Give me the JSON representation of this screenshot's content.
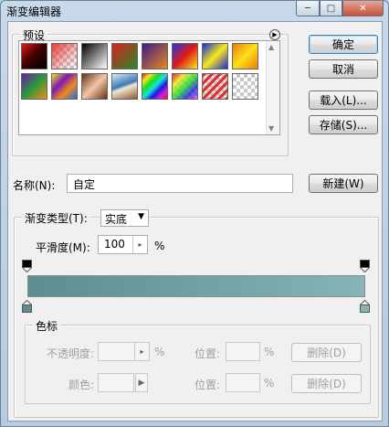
{
  "window": {
    "title": "渐变编辑器",
    "controls": {
      "minimize": "─",
      "maximize": "□",
      "close": "✕"
    }
  },
  "presets": {
    "label": "预设",
    "menu_icon": "right-arrow-circle",
    "swatches": [
      {
        "name": "foreground-to-background",
        "css": "linear-gradient(135deg,#e21a1a 0%,#400 45%,#000 100%)"
      },
      {
        "name": "foreground-to-transparent",
        "css": "linear-gradient(135deg,#e63c3c 0%,rgba(230,60,60,0.3) 60%,rgba(230,60,60,0) 100%)",
        "checker": true
      },
      {
        "name": "black-white",
        "css": "linear-gradient(135deg,#000 0%,#fff 100%)"
      },
      {
        "name": "red-green",
        "css": "linear-gradient(135deg,#d62020 0%,#2a8a2a 100%)"
      },
      {
        "name": "violet-orange",
        "css": "linear-gradient(135deg,#3a1a8a 0%,#e78a1a 100%)"
      },
      {
        "name": "blue-red-yellow",
        "css": "linear-gradient(135deg,#1a3ae0 0%,#e01a1a 50%,#f6e61a 100%)"
      },
      {
        "name": "blue-yellow-blue",
        "css": "linear-gradient(135deg,#1a2ad8 0%,#f6e81a 50%,#1a2ad8 100%)"
      },
      {
        "name": "orange-yellow-orange",
        "css": "linear-gradient(135deg,#ef7a0a 0%,#fbe21a 50%,#ef7a0a 100%)"
      },
      {
        "name": "violet-green-orange",
        "css": "linear-gradient(135deg,#6a1aa8 0%,#2a9a3a 50%,#f08a1a 100%)"
      },
      {
        "name": "yellow-violet-orange-blue",
        "css": "linear-gradient(135deg,#f6e21a 0%,#7a1ab8 35%,#f08a1a 65%,#1a6ae0 100%)"
      },
      {
        "name": "copper",
        "css": "linear-gradient(135deg,#6a3010 0%,#f0c8a8 50%,#6a3010 100%)"
      },
      {
        "name": "chrome",
        "css": "linear-gradient(160deg,#d8ecf8 0%,#3a7ab8 45%,#f0e8d0 55%,#8a5a30 100%)"
      },
      {
        "name": "spectrum",
        "css": "linear-gradient(135deg,#e01a1a,#f6e61a,#1ae01a,#1ae0e0,#1a1ae0,#e01ae0,#e01a1a)"
      },
      {
        "name": "transparent-rainbow",
        "css": "linear-gradient(135deg,rgba(224,26,26,0.9),rgba(246,230,26,0.8),rgba(26,224,26,0.8),rgba(26,26,224,0.8),rgba(224,26,224,0.6))",
        "checker": true
      },
      {
        "name": "transparent-stripes",
        "css": "repeating-linear-gradient(135deg,#e03030 0 3px,transparent 3px 6px)",
        "checker": true
      },
      {
        "name": "transparent-checker",
        "css": "none",
        "checker": true
      }
    ]
  },
  "buttons": {
    "ok": "确定",
    "cancel": "取消",
    "load": "载入(L)...",
    "save": "存储(S)...",
    "new": "新建(W)"
  },
  "name": {
    "label": "名称(N):",
    "value": "自定"
  },
  "gradient": {
    "type_label": "渐变类型(T):",
    "type_value": "实底",
    "smoothness_label": "平滑度(M):",
    "smoothness_value": "100",
    "smoothness_unit": "%",
    "colors": {
      "start": "#5d8d8f",
      "end": "#86b4b7"
    }
  },
  "stops": {
    "label": "色标",
    "opacity_label": "不透明度:",
    "opacity_unit": "%",
    "color_label": "颜色:",
    "location_label": "位置:",
    "location_unit": "%",
    "location_label_2": "位置:",
    "location_unit_2": "%",
    "delete_label": "删除(D)",
    "delete_label_2": "删除(D)"
  }
}
